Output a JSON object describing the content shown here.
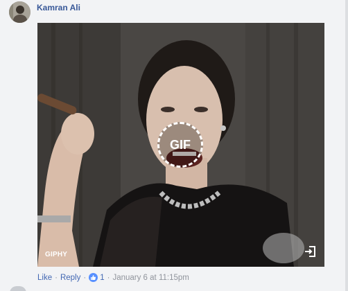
{
  "comment": {
    "author": "Kamran Ali",
    "avatar_icon": "user-avatar",
    "gif": {
      "badge": "GIF",
      "provider": "GIPHY",
      "open_icon": "open-external-icon"
    },
    "actions": {
      "like": "Like",
      "separator": "·",
      "reply": "Reply",
      "reaction_icon": "thumbs-up-icon",
      "reaction_count": "1",
      "timestamp": "January 6 at 11:15pm"
    }
  },
  "colors": {
    "link": "#385898",
    "action_link": "#4267b2",
    "meta": "#90949c",
    "like_badge": "#5890ff"
  }
}
